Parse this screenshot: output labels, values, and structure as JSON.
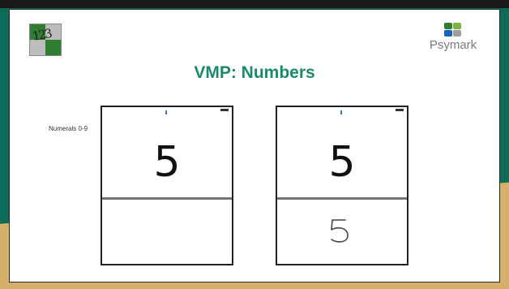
{
  "slide": {
    "title": "VMP: Numbers",
    "label": "Numerals 0-9",
    "brand": "Psymark",
    "logo_text": "123"
  },
  "screens": [
    {
      "digit": "5",
      "handwritten": false
    },
    {
      "digit": "5",
      "handwritten": true
    }
  ],
  "colors": {
    "title": "#1b8a6b",
    "background_green": "#0f6b57",
    "background_tan": "#d4b06a",
    "logo_green": "#2e7d32"
  },
  "icons": [
    "numbers-logo-icon",
    "psymark-logo-icon"
  ]
}
